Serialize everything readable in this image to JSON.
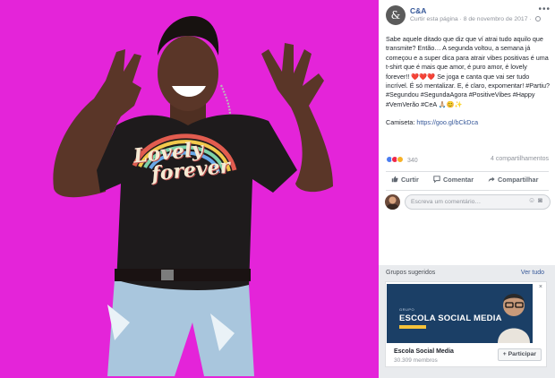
{
  "photo": {
    "background_color": "#e424d9",
    "shirt_print_line1": "Lovely",
    "shirt_print_line2": "forever"
  },
  "post": {
    "page_name": "C&A",
    "page_avatar_glyph": "&",
    "meta_text": "Curtir esta página · 8 de novembro de 2017 ·",
    "more_icon": "more-options-icon",
    "text_p1": "Sabe aquele ditado que diz que ví atrai tudo aquilo que transmite? Então… A segunda voltou, a semana já começou e a super dica para atrair vibes positivas é uma t-shirt que é mais que amor, é puro amor, é lovely forever!! ❤️❤️❤️ Se joga e canta que vai ser tudo incrível. É só mentalizar. E, é claro, expomentar! #Partiu? #Segundou #SegundaAgora #PositiveVibes #Happy #VemVerão #CeA 🙏🏼😊✨",
    "text_p2_label": "Camiseta: ",
    "text_p2_link": "https://goo.gl/bCkDca"
  },
  "reactions": {
    "count": "340",
    "shares": "4 compartilhamentos",
    "colors": {
      "like": "#4a7df0",
      "love": "#f0284a",
      "haha": "#f7b125"
    }
  },
  "actions": {
    "like_label": "Curtir",
    "comment_label": "Comentar",
    "share_label": "Compartilhar"
  },
  "comment": {
    "placeholder": "Escreva um comentário…",
    "icons": [
      "emoji-icon",
      "camera-icon"
    ]
  },
  "groups": {
    "title": "Grupos sugeridos",
    "see_all": "Ver tudo",
    "card": {
      "banner_small": "GRUPO",
      "banner_title": "ESCOLA SOCIAL MEDIA",
      "name": "Escola Social Media",
      "members": "30.309 membros",
      "join_label": "+ Participar",
      "close": "×"
    }
  },
  "colors": {
    "link": "#365899",
    "muted": "#90949c",
    "banner": "#1b3f66"
  }
}
